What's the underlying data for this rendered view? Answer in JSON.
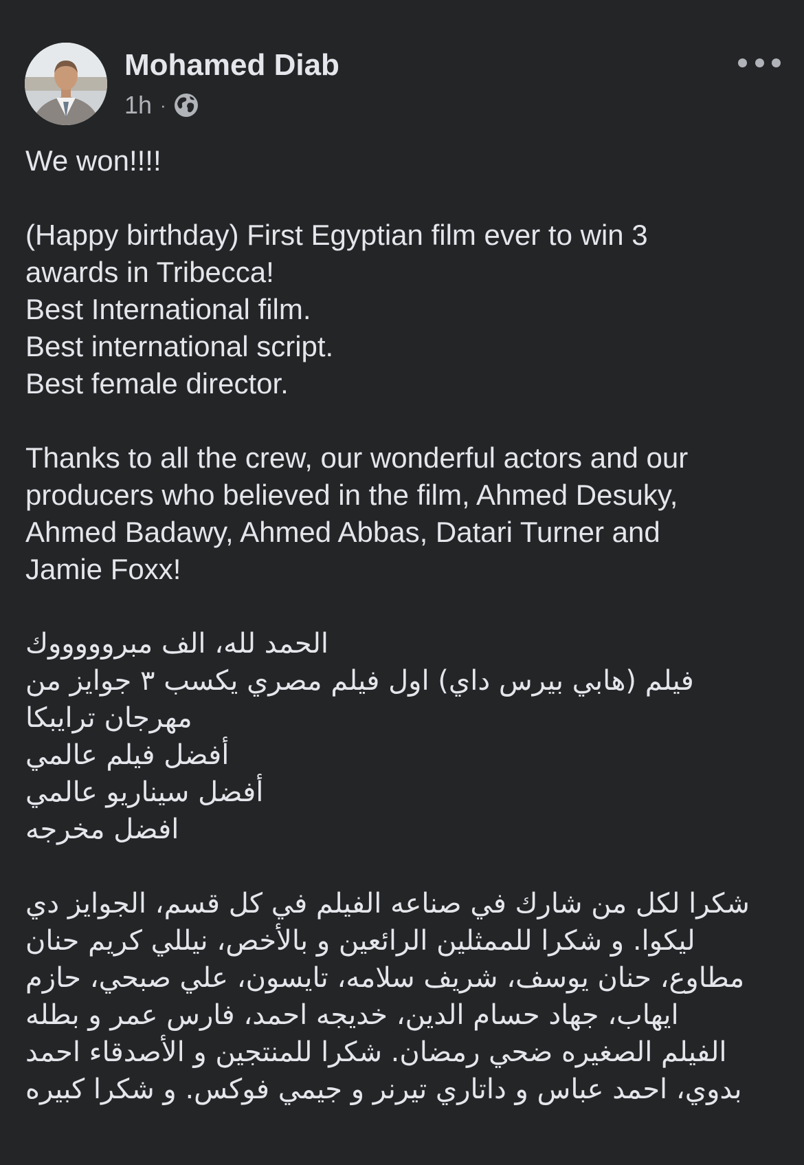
{
  "post": {
    "author": "Mohamed Diab",
    "time": "1h",
    "separator": "·",
    "privacy_icon": "globe-icon",
    "more_icon": "more-options-icon",
    "avatar_icon": "profile-photo"
  },
  "body": {
    "en": [
      "We won!!!!",
      "",
      "(Happy birthday) First Egyptian film ever to win 3",
      "awards in Tribecca!",
      "Best International film.",
      "Best international script.",
      "Best female director.",
      "",
      "Thanks to all the crew, our wonderful actors and our",
      "producers who believed in the film, Ahmed Desuky,",
      "Ahmed Badawy, Ahmed Abbas, Datari Turner and",
      "Jamie Foxx!"
    ],
    "ar": [
      "الحمد لله، الف مبروووووك",
      "فيلم (هابي بيرس داي) اول فيلم مصري يكسب ٣ جوايز من",
      "مهرجان ترايبكا",
      "أفضل فيلم عالمي",
      "أفضل سيناريو عالمي",
      "افضل مخرجه",
      "",
      "شكرا لكل من شارك في صناعه الفيلم في كل قسم، الجوايز دي",
      "ليكوا. و شكرا  للممثلين الرائعين و بالأخص، نيللي كريم حنان",
      "مطاوع، حنان يوسف، شريف سلامه، تايسون، علي صبحي، حازم",
      "ايهاب، جهاد حسام الدين، خديجه احمد، فارس عمر و بطله",
      "الفيلم الصغيره ضحي رمضان. شكرا للمنتجين و الأصدقاء احمد",
      "بدوي، احمد عباس و داتاري تيرنر و جيمي فوكس. و شكرا كبيره"
    ]
  },
  "colors": {
    "background": "#242527",
    "text_primary": "#e4e6eb",
    "text_secondary": "#b0b3b8"
  }
}
